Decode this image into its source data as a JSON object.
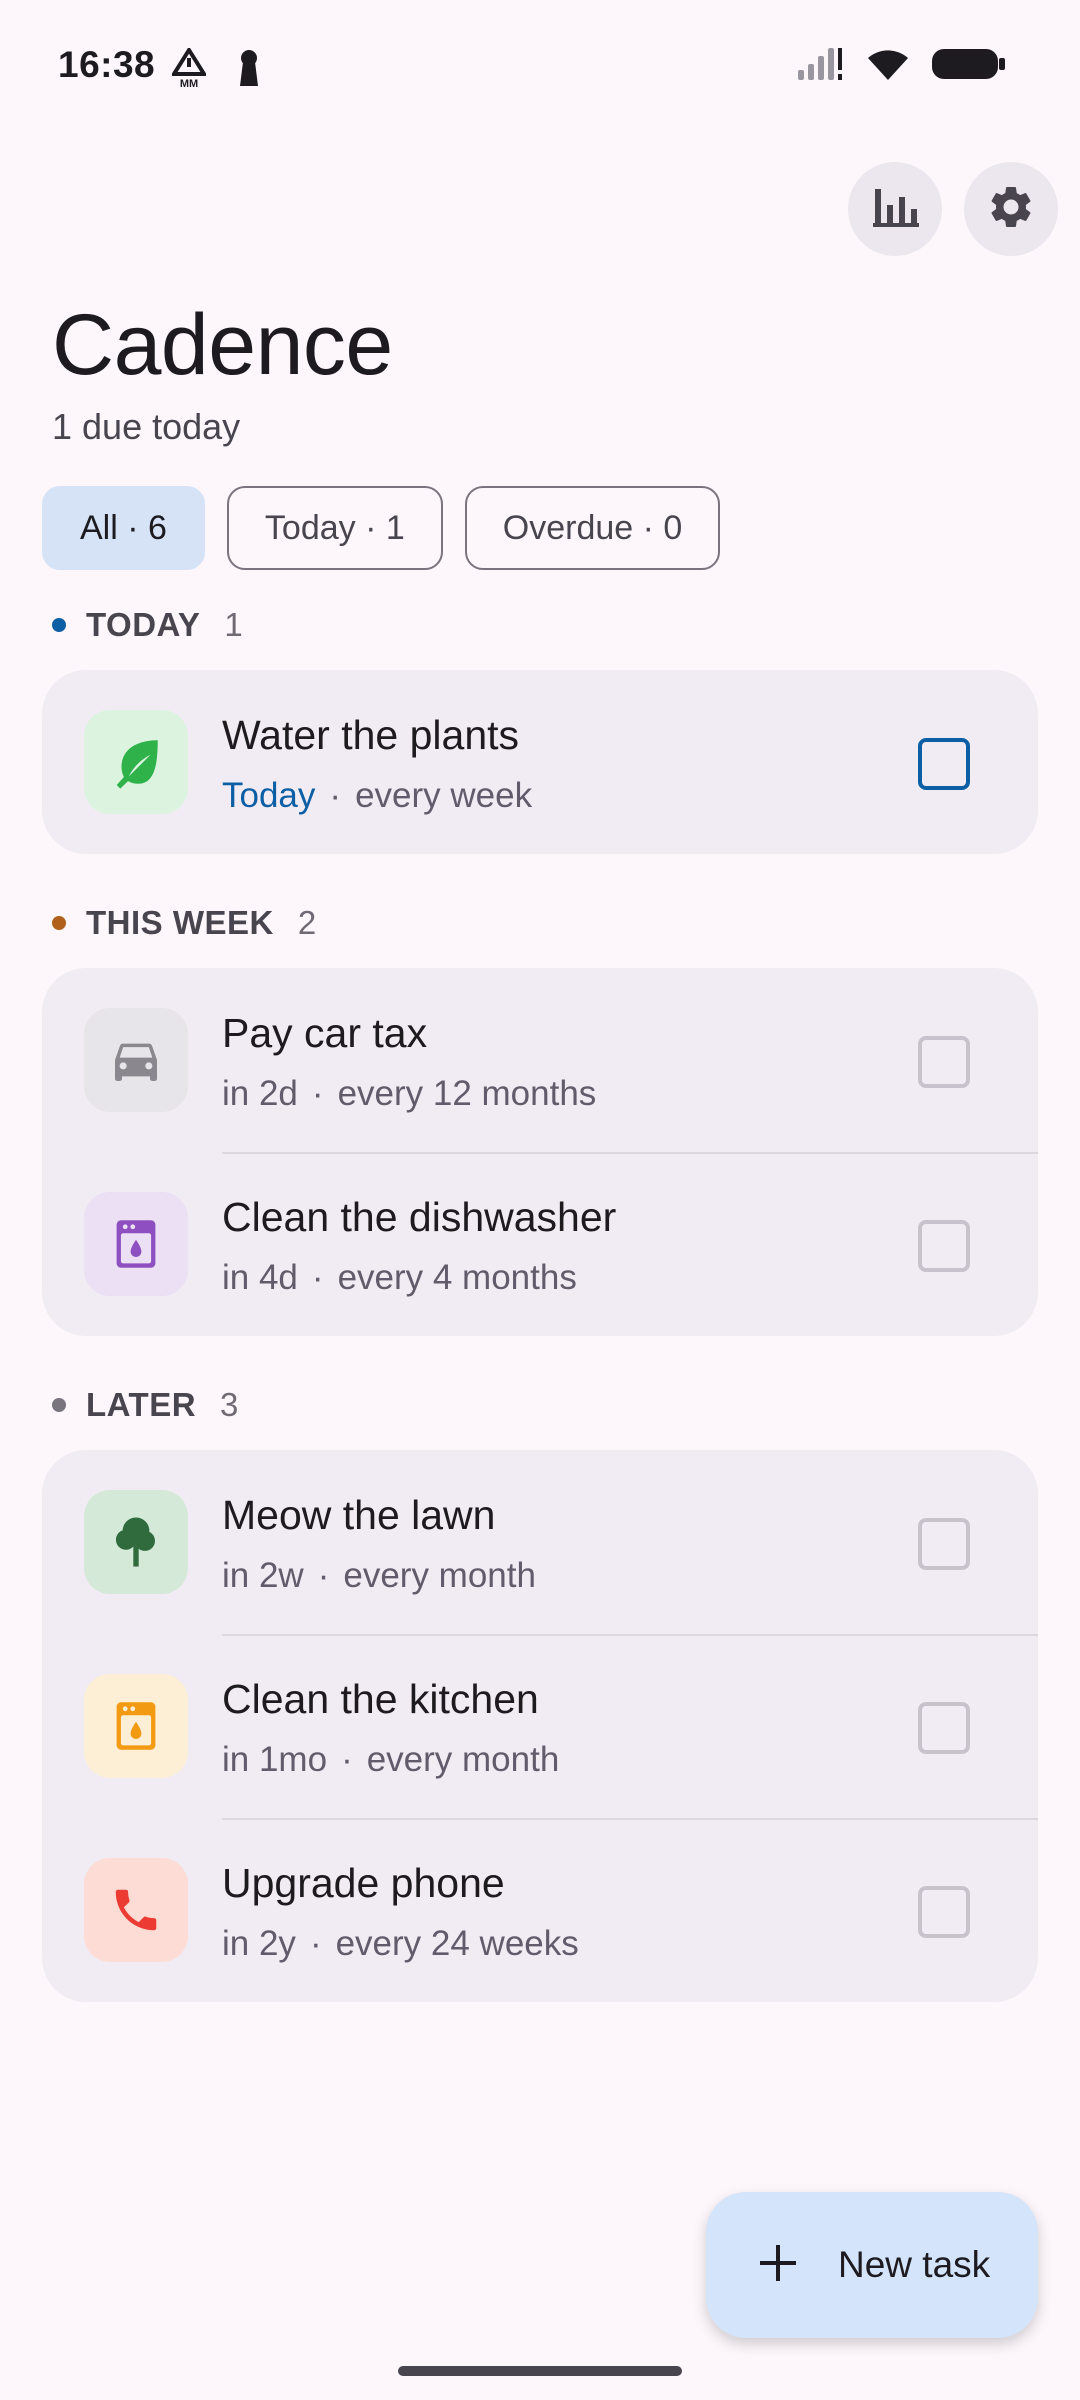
{
  "status_bar": {
    "time": "16:38",
    "icons": [
      "warning-mm-icon",
      "keyhole-icon",
      "signal-icon",
      "wifi-icon",
      "battery-icon"
    ]
  },
  "actions": {
    "stats_icon": "bar-chart-icon",
    "settings_icon": "gear-icon"
  },
  "header": {
    "title": "Cadence",
    "subtitle": "1 due today"
  },
  "filters": [
    {
      "label": "All · 6",
      "selected": true
    },
    {
      "label": "Today · 1",
      "selected": false
    },
    {
      "label": "Overdue · 0",
      "selected": false
    }
  ],
  "sections": {
    "today": {
      "title": "TODAY",
      "count": "1",
      "dot_color": "#0d5fa5",
      "tasks": [
        {
          "title": "Water the plants",
          "due": "Today",
          "recurrence": "every week",
          "icon": "leaf-icon",
          "icon_bg": "#dcf3e0",
          "icon_color": "#2fb24a",
          "checked": false
        }
      ]
    },
    "this_week": {
      "title": "THIS WEEK",
      "count": "2",
      "dot_color": "#b1601b",
      "tasks": [
        {
          "title": "Pay car tax",
          "due": "in 2d",
          "recurrence": "every 12 months",
          "icon": "car-icon",
          "icon_bg": "#e8e5ea",
          "icon_color": "#8a878f",
          "checked": false
        },
        {
          "title": "Clean the dishwasher",
          "due": "in 4d",
          "recurrence": "every 4 months",
          "icon": "dishwasher-icon",
          "icon_bg": "#ece0f4",
          "icon_color": "#8e4fc0",
          "checked": false
        }
      ]
    },
    "later": {
      "title": "LATER",
      "count": "3",
      "dot_color": "#79747e",
      "tasks": [
        {
          "title": "Meow the lawn",
          "due": "in 2w",
          "recurrence": "every month",
          "icon": "tree-icon",
          "icon_bg": "#d5e9d9",
          "icon_color": "#2f6b3d",
          "checked": false
        },
        {
          "title": "Clean the kitchen",
          "due": "in 1mo",
          "recurrence": "every month",
          "icon": "appliance-icon",
          "icon_bg": "#fdefd6",
          "icon_color": "#f29a12",
          "checked": false
        },
        {
          "title": "Upgrade phone",
          "due": "in 2y",
          "recurrence": "every 24 weeks",
          "icon": "phone-icon",
          "icon_bg": "#fddcd6",
          "icon_color": "#ec3b33",
          "checked": false
        }
      ]
    }
  },
  "fab": {
    "label": "New task",
    "icon": "plus-icon"
  }
}
